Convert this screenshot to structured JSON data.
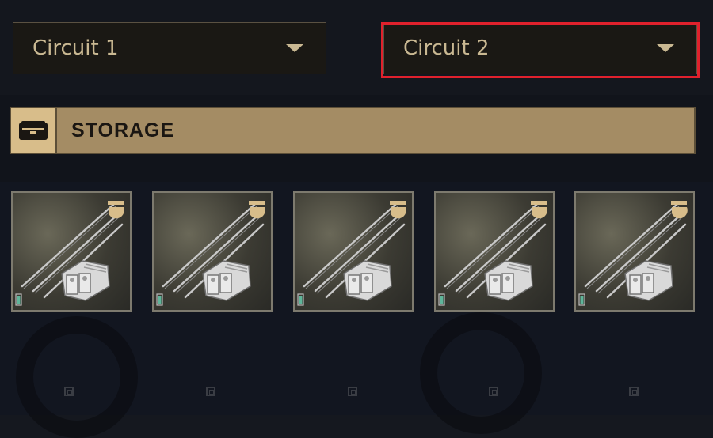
{
  "dropdowns": [
    {
      "label": "Circuit 1",
      "selected": false
    },
    {
      "label": "Circuit 2",
      "selected": true
    }
  ],
  "storage": {
    "label": "STORAGE",
    "icon": "storage-chest-icon"
  },
  "inventory": {
    "slots": [
      {
        "item": "circuit-weapon-parts",
        "rarity_color": "#d8bd8a",
        "indicator_color": "#5fb59a"
      },
      {
        "item": "circuit-weapon-parts",
        "rarity_color": "#d8bd8a",
        "indicator_color": "#5fb59a"
      },
      {
        "item": "circuit-weapon-parts",
        "rarity_color": "#d8bd8a",
        "indicator_color": "#5fb59a"
      },
      {
        "item": "circuit-weapon-parts",
        "rarity_color": "#d8bd8a",
        "indicator_color": "#5fb59a"
      },
      {
        "item": "circuit-weapon-parts",
        "rarity_color": "#d8bd8a",
        "indicator_color": "#5fb59a"
      }
    ]
  },
  "colors": {
    "accent": "#c9b892",
    "highlight": "#e0212c",
    "storage_bar": "#a48c64"
  }
}
